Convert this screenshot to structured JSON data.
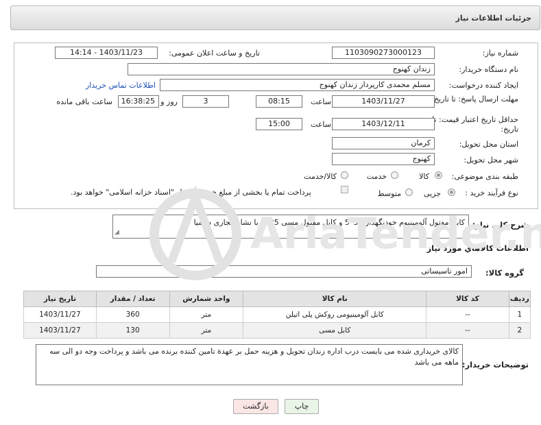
{
  "header": {
    "title": "جزئیات اطلاعات نیاز"
  },
  "form": {
    "need_number_label": "شماره نیاز:",
    "need_number": "1103090273000123",
    "announce_label": "تاریخ و ساعت اعلان عمومی:",
    "announce_value": "1403/11/23 - 14:14",
    "buyer_label": "نام دستگاه خریدار:",
    "buyer_value": "زندان کهنوج",
    "requester_label": "ایجاد کننده درخواست:",
    "requester_value": "مسلم محمدی کارپرداز زندان کهنوج",
    "contact_link": "اطلاعات تماس خریدار",
    "deadline_label": "مهلت ارسال پاسخ: تا تاریخ:",
    "deadline_date": "1403/11/27",
    "time_label": "ساعت",
    "deadline_time": "08:15",
    "days_value": "3",
    "days_label": "روز و",
    "remain_time": "16:38:25",
    "remain_label": "ساعت باقی مانده",
    "validity_label": "حداقل تاریخ اعتبار قیمت: تا تاریخ:",
    "validity_date": "1403/12/11",
    "validity_time": "15:00",
    "province_label": "استان محل تحویل:",
    "province_value": "کرمان",
    "city_label": "شهر محل تحویل:",
    "city_value": "کهنوج",
    "category_label": "طبقه بندی موضوعی:",
    "category_options": [
      "کالا",
      "خدمت",
      "کالا/خدمت"
    ],
    "process_label": "نوع فرآیند خرید :",
    "process_options": [
      "جزیی",
      "متوسط"
    ],
    "payment_note": "پرداخت تمام یا بخشی از مبلغ خرید،از محل \"اسناد خزانه اسلامی\" خواهد بود."
  },
  "summary": {
    "label": "شرح کلي نياز:",
    "value": "کابل مفتول آلومینیوم خودنگهدار 35*5 و کابل مفتول مسی 25*4 با نشان تجاری سیمیا"
  },
  "items_section": {
    "title": "اطلاعات کالاهاي مورد نياز",
    "group_label": "گروه کالا:",
    "group_value": "امور تاسیساتی"
  },
  "table": {
    "columns": [
      "ردیف",
      "کد کالا",
      "نام کالا",
      "واحد شمارش",
      "تعداد / مقدار",
      "تاریخ نیاز"
    ],
    "rows": [
      [
        "1",
        "--",
        "کابل آلومینیومی روکش پلی اتیلن",
        "متر",
        "360",
        "1403/11/27"
      ],
      [
        "2",
        "--",
        "کابل مسی",
        "متر",
        "130",
        "1403/11/27"
      ]
    ]
  },
  "notes": {
    "label": "توضیحات خریدار:",
    "value": "کالای خریداری شده می بایست درب اداره زندان تحویل و هزینه حمل بر عهدة تامین کننده برنده می باشد و پرداخت وجه دو الی سه ماهه می باشد"
  },
  "buttons": {
    "print": "چاپ",
    "back": "بازگشت"
  },
  "watermark": {
    "text": "AriaTender.net"
  }
}
